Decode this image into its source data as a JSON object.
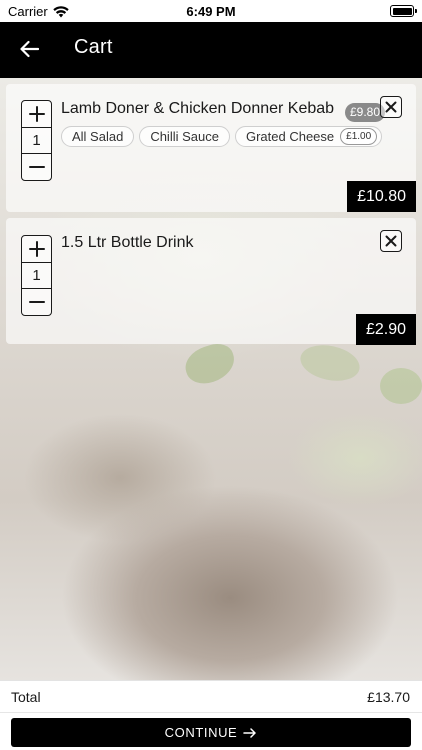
{
  "status_bar": {
    "carrier": "Carrier",
    "time": "6:49 PM"
  },
  "header": {
    "title": "Cart",
    "back_icon": "arrow-left-icon"
  },
  "cart": {
    "items": [
      {
        "name": "Lamb Doner & Chicken Donner Kebab",
        "quantity": "1",
        "unit_price": "£9.80",
        "options": [
          {
            "label": "All Salad"
          },
          {
            "label": "Chilli Sauce"
          },
          {
            "label": "Grated Cheese",
            "price": "£1.00"
          }
        ],
        "total": "£10.80"
      },
      {
        "name": "1.5 Ltr Bottle Drink",
        "quantity": "1",
        "total": "£2.90"
      }
    ]
  },
  "footer": {
    "total_label": "Total",
    "total_value": "£13.70",
    "continue_label": "CONTINUE"
  },
  "colors": {
    "header_bg": "#000000",
    "accent": "#000000",
    "badge_bg": "#8a8a8a"
  }
}
